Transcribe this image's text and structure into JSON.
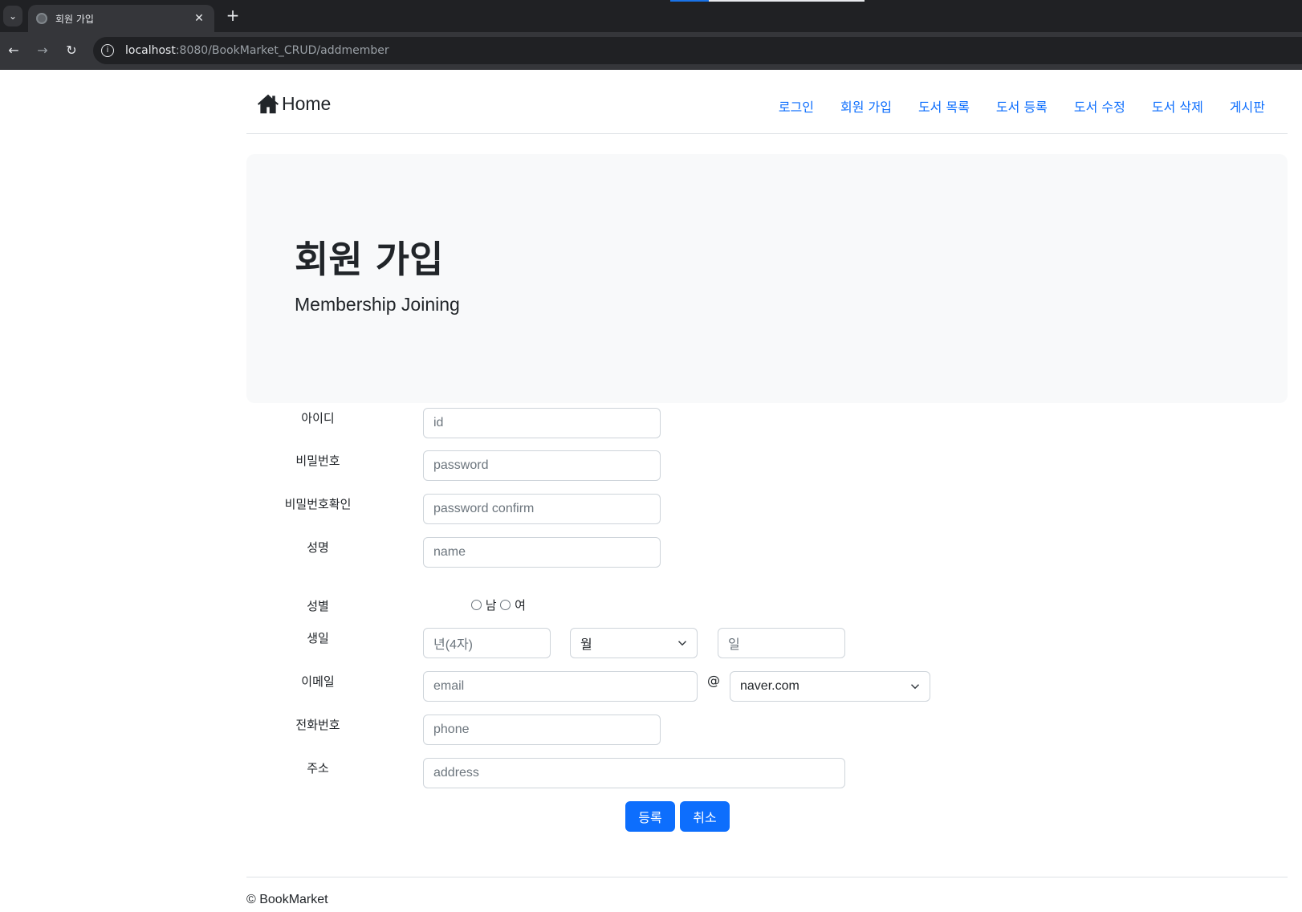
{
  "browser": {
    "tab_title": "회원 가입",
    "url_host": "localhost",
    "url_path": ":8080/BookMarket_CRUD/addmember"
  },
  "navbar": {
    "brand": "Home",
    "links": [
      "로그인",
      "회원 가입",
      "도서 목록",
      "도서 등록",
      "도서 수정",
      "도서 삭제",
      "게시판"
    ]
  },
  "jumbotron": {
    "title": "회원 가입",
    "subtitle": "Membership Joining"
  },
  "form": {
    "id_label": "아이디",
    "id_placeholder": "id",
    "password_label": "비밀번호",
    "password_placeholder": "password",
    "password_confirm_label": "비밀번호확인",
    "password_confirm_placeholder": "password confirm",
    "name_label": "성명",
    "name_placeholder": "name",
    "gender_label": "성별",
    "gender_male": "남",
    "gender_female": "여",
    "birth_label": "생일",
    "birth_year_placeholder": "년(4자)",
    "birth_month_value": "월",
    "birth_day_placeholder": "일",
    "email_label": "이메일",
    "email_placeholder": "email",
    "email_at": "@",
    "email_domain_value": "naver.com",
    "phone_label": "전화번호",
    "phone_placeholder": "phone",
    "address_label": "주소",
    "address_placeholder": "address",
    "submit_label": "등록",
    "cancel_label": "취소"
  },
  "footer": {
    "text": "© BookMarket"
  },
  "colors": {
    "primary": "#0d6efd",
    "jumbotron_bg": "#f8f9fa"
  }
}
